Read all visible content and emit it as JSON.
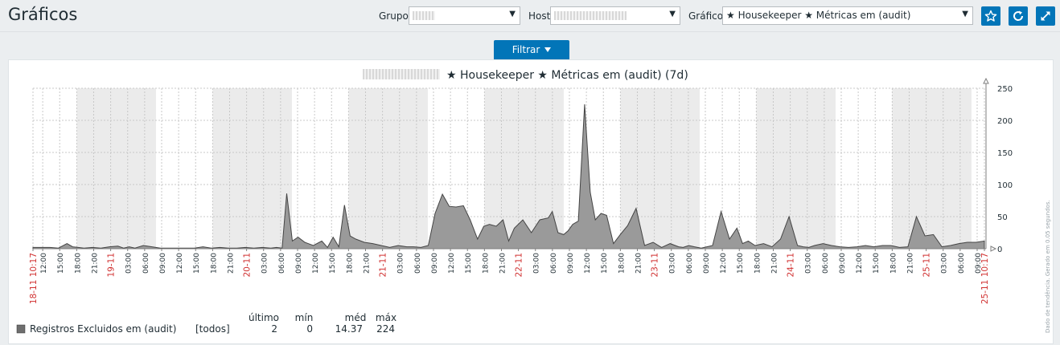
{
  "header": {
    "title": "Gráficos"
  },
  "filters": {
    "group_label": "Grupo",
    "host_label": "Host",
    "graph_label": "Gráfico",
    "graph_value": "★ Housekeeper ★ Métricas em (audit)"
  },
  "filter_button": {
    "label": "Filtrar"
  },
  "icons": {
    "favorite": "star-icon",
    "refresh": "refresh-icon",
    "fullscreen": "fullscreen-icon",
    "dropdown": "chevron-down-icon"
  },
  "colors": {
    "accent": "#0275b8",
    "series_fill": "#9a9a9a",
    "series_line": "#444444",
    "date_label": "#d03030",
    "off_hours_band": "#ebebeb"
  },
  "chart_data": {
    "type": "area",
    "title": "★ Housekeeper ★ Métricas em (audit)  (7d)",
    "ylim": [
      0,
      250
    ],
    "y_ticks": [
      0,
      50,
      100,
      150,
      200,
      250
    ],
    "x_range": [
      "18-11 10:17",
      "25-11 10:17"
    ],
    "x_tick_labels": [
      "18-11 10:17",
      "12:00",
      "15:00",
      "18:00",
      "21:00",
      "19-11",
      "03:00",
      "06:00",
      "09:00",
      "12:00",
      "15:00",
      "18:00",
      "21:00",
      "20-11",
      "03:00",
      "06:00",
      "09:00",
      "12:00",
      "15:00",
      "18:00",
      "21:00",
      "21-11",
      "03:00",
      "06:00",
      "09:00",
      "12:00",
      "15:00",
      "18:00",
      "21:00",
      "22-11",
      "03:00",
      "06:00",
      "09:00",
      "12:00",
      "15:00",
      "18:00",
      "21:00",
      "23-11",
      "03:00",
      "06:00",
      "09:00",
      "12:00",
      "15:00",
      "18:00",
      "21:00",
      "24-11",
      "03:00",
      "06:00",
      "09:00",
      "12:00",
      "15:00",
      "18:00",
      "21:00",
      "25-11",
      "03:00",
      "06:00",
      "09:00",
      "25-11 10:17"
    ],
    "grid": true,
    "legend": {
      "headers": [
        "último",
        "mín",
        "méd",
        "máx"
      ],
      "items": [
        {
          "name": "Registros Excluidos em (audit)",
          "func": "[todos]",
          "last": "2",
          "min": "0",
          "avg": "14.37",
          "max": "224"
        }
      ]
    },
    "side_note": "Dado de tendência. Gerado em 0.05 segundos.",
    "series": [
      {
        "name": "Registros Excluidos em (audit)",
        "x_hours": [
          0,
          1.5,
          3,
          4.5,
          6,
          7,
          8,
          9,
          10.5,
          12,
          13.5,
          15,
          16,
          17,
          18,
          19.5,
          21,
          22.5,
          24,
          25.5,
          27,
          28.5,
          30,
          31.5,
          33,
          34.5,
          36,
          37.5,
          39,
          40.5,
          42,
          43,
          44,
          44.8,
          45.8,
          46.8,
          48,
          49.5,
          51,
          52,
          53,
          54,
          55,
          56,
          57,
          58.5,
          60,
          61.5,
          63,
          64.5,
          66,
          67.2,
          68.5,
          69.8,
          71,
          72.3,
          73.5,
          74.7,
          76,
          77.2,
          78.5,
          79.6,
          80.6,
          81.8,
          83,
          84,
          85,
          86.5,
          88,
          89.5,
          91,
          91.7,
          92.7,
          93.7,
          94.5,
          95.3,
          96.3,
          97.4,
          98.4,
          99.3,
          100.3,
          101.3,
          102.5,
          103.7,
          105,
          106.5,
          108,
          109.5,
          111,
          112.5,
          114,
          114.8,
          115.8,
          116.8,
          118,
          119,
          120,
          121.5,
          123,
          124.3,
          125.3,
          126.3,
          127.5,
          129,
          130.5,
          132,
          133.5,
          135,
          136,
          137,
          138,
          139.5,
          141,
          142.5,
          144,
          145.5,
          147,
          148.5,
          150,
          151.5,
          153,
          154.5,
          156,
          157.5,
          159,
          160.5,
          162,
          163.5,
          165,
          166.5,
          168
        ],
        "values": [
          2,
          2,
          2,
          1,
          8,
          3,
          2,
          1,
          2,
          1,
          3,
          4,
          1,
          3,
          1,
          5,
          3,
          1,
          1,
          1,
          1,
          1,
          3,
          1,
          2,
          1,
          1,
          2,
          1,
          2,
          1,
          2,
          1,
          86,
          12,
          18,
          10,
          5,
          12,
          2,
          18,
          3,
          68,
          20,
          15,
          10,
          8,
          5,
          2,
          5,
          3,
          3,
          2,
          5,
          55,
          85,
          66,
          65,
          67,
          45,
          15,
          35,
          38,
          35,
          45,
          12,
          32,
          45,
          25,
          45,
          48,
          58,
          25,
          22,
          28,
          38,
          43,
          225,
          88,
          45,
          55,
          52,
          8,
          22,
          36,
          63,
          5,
          10,
          2,
          8,
          3,
          2,
          5,
          3,
          1,
          3,
          5,
          58,
          15,
          32,
          8,
          12,
          5,
          8,
          3,
          15,
          50,
          5,
          3,
          2,
          5,
          8,
          5,
          3,
          2,
          3,
          5,
          3,
          5,
          5,
          2,
          3,
          50,
          20,
          22,
          3,
          5,
          8,
          10,
          10,
          12,
          10,
          3,
          1,
          2,
          2,
          2,
          3,
          3,
          3,
          5,
          2,
          2,
          2,
          1,
          3,
          2,
          2
        ]
      }
    ]
  }
}
